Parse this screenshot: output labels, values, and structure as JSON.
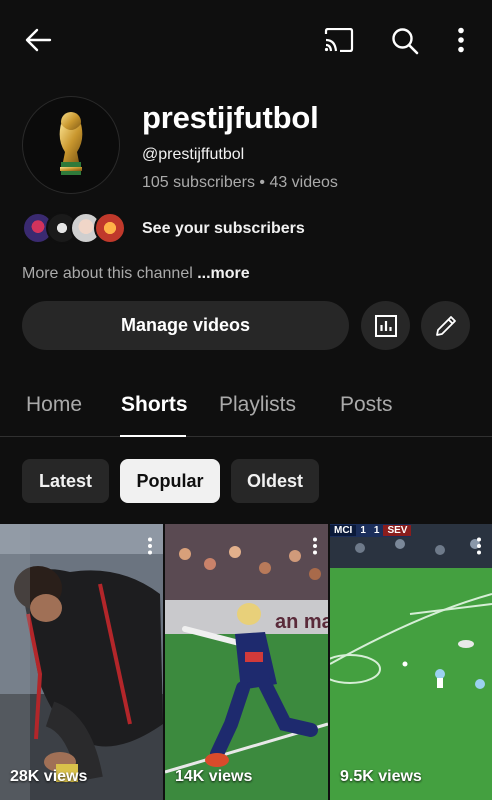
{
  "header": {
    "back_icon": "arrow-left-icon",
    "cast_icon": "cast-icon",
    "search_icon": "search-icon",
    "menu_icon": "more-vertical-icon"
  },
  "channel": {
    "name": "prestijfutbol",
    "handle": "@prestijffutbol",
    "stats": "105 subscribers • 43 videos",
    "avatar_icon": "world-cup-trophy"
  },
  "subscribers": {
    "label": "See your subscribers"
  },
  "about": {
    "text": "More about this channel ",
    "more": "...more"
  },
  "actions": {
    "manage_label": "Manage videos",
    "analytics_icon": "analytics-icon",
    "edit_icon": "pencil-icon"
  },
  "tabs": [
    {
      "label": "Home"
    },
    {
      "label": "Shorts",
      "active": true
    },
    {
      "label": "Playlists"
    },
    {
      "label": "Posts"
    }
  ],
  "filters": [
    {
      "label": "Latest"
    },
    {
      "label": "Popular",
      "selected": true
    },
    {
      "label": "Oldest"
    }
  ],
  "shorts": [
    {
      "views": "28K views"
    },
    {
      "views": "14K views"
    },
    {
      "views": "9.5K views",
      "scoreboard": {
        "home": "MCI",
        "home_score": "1",
        "away_score": "1",
        "away": "SEV"
      }
    }
  ],
  "colors": {
    "background": "#0f0f0f",
    "surface": "#272727",
    "text_secondary": "#aaaaaa"
  }
}
